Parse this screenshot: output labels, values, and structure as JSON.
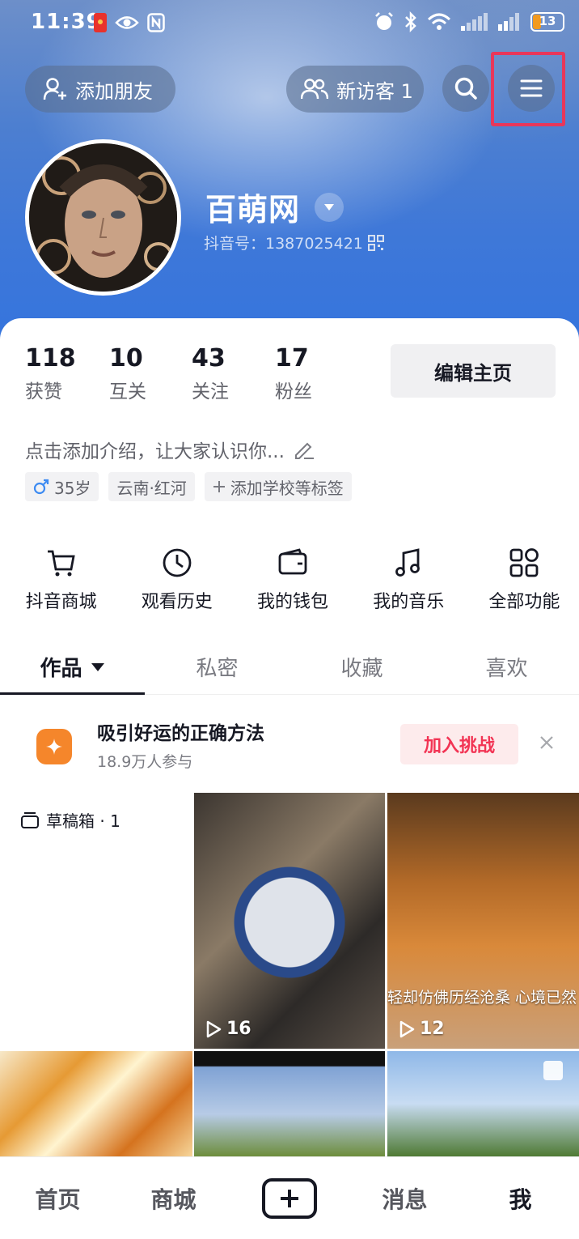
{
  "status_bar": {
    "time": "11:39",
    "battery": "13"
  },
  "header": {
    "add_friend_label": "添加朋友",
    "visitor_label": "新访客 1"
  },
  "profile": {
    "name": "百萌网",
    "douyin_id": "抖音号：1387025421"
  },
  "stats": [
    {
      "num": "118",
      "label": "获赞"
    },
    {
      "num": "10",
      "label": "互关"
    },
    {
      "num": "43",
      "label": "关注"
    },
    {
      "num": "17",
      "label": "粉丝"
    }
  ],
  "edit_profile_label": "编辑主页",
  "bio": "点击添加介绍，让大家认识你...",
  "tags": [
    "35岁",
    "云南·红河",
    "添加学校等标签"
  ],
  "tools": [
    {
      "label": "抖音商城",
      "icon": "cart-icon"
    },
    {
      "label": "观看历史",
      "icon": "clock-icon"
    },
    {
      "label": "我的钱包",
      "icon": "wallet-icon"
    },
    {
      "label": "我的音乐",
      "icon": "music-icon"
    },
    {
      "label": "全部功能",
      "icon": "grid-icon"
    }
  ],
  "tabs": [
    "作品",
    "私密",
    "收藏",
    "喜欢"
  ],
  "challenge": {
    "title": "吸引好运的正确方法",
    "subtitle": "18.9万人参与",
    "join_label": "加入挑战"
  },
  "drafts": "草稿箱 · 1",
  "videos": [
    {
      "plays": "16"
    },
    {
      "plays": "12",
      "subtitle": "轻却仿佛历经沧桑 心境已然"
    }
  ],
  "bottom_nav": [
    "首页",
    "商城",
    "消息",
    "我"
  ],
  "colors": {
    "accent_red": "#f23454",
    "highlight": "#e8375a",
    "header_blue": "#3f78d8"
  }
}
